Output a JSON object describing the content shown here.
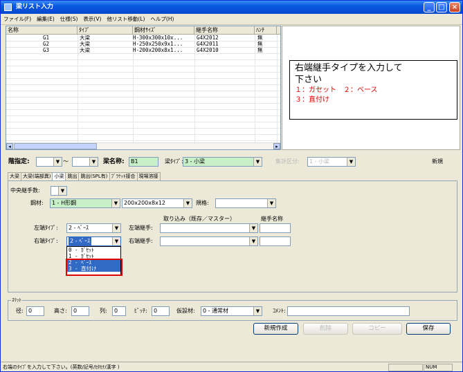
{
  "window": {
    "title": "梁リスト入力"
  },
  "menu": [
    "ファイル(F)",
    "編集(E)",
    "仕様(S)",
    "表示(V)",
    "他リスト移動(L)",
    "ヘルプ(H)"
  ],
  "list": {
    "headers": [
      "名称",
      "ﾀｲﾌﾟ",
      "鋼材ｻｲｽﾞ",
      "継手名称",
      "ﾊﾝﾁ"
    ],
    "rows": [
      [
        "G1",
        "大梁",
        "H-300x300x10x...",
        "G4X2012",
        "無"
      ],
      [
        "G2",
        "大梁",
        "H-250x250x9x1...",
        "G4X2011",
        "無"
      ],
      [
        "G3",
        "大梁",
        "H-200x200x8x1...",
        "G4X2010",
        "無"
      ]
    ]
  },
  "message": {
    "line1": "右端継手タイプを入力して",
    "line2": "下さい",
    "line3": "１：ガセット　２：ベース",
    "line4": "３：直付け"
  },
  "header_form": {
    "floor_label": "階指定:",
    "tilde": "～",
    "name_label": "梁名称:",
    "name_value": "B1",
    "type_label": "梁ﾀｲﾌﾟ:",
    "type_value": "3 - 小梁",
    "agg_label": "集計区分:",
    "agg_value": "1 - 小梁",
    "new_button": "新規"
  },
  "tabs": [
    "大梁",
    "大梁(端部異)",
    "小梁",
    "跳出",
    "跳出(SPL有)",
    "ﾌﾞﾗｹｯﾄ接合",
    "現場溶接"
  ],
  "active_tab": 2,
  "beam_form": {
    "center_joint_label": "中央継手数:",
    "steel_label": "鋼材:",
    "steel_type": "1 - H形鋼",
    "steel_size": "200x200x8x12",
    "spec_label": "規格:",
    "import_label": "取り込み（既存／マスター）",
    "joint_name_label": "継手名称",
    "left_type_label": "左端ﾀｲﾌﾟ:",
    "left_type_value": "2 - ﾍﾞｰｽ",
    "left_joint_label": "左端継手:",
    "right_type_label": "右端ﾀｲﾌﾟ:",
    "right_type_value": "2 - ﾍﾞｰｽ",
    "right_joint_label": "右端継手:"
  },
  "dropdown": {
    "options": [
      "0 - ｶﾞｾｯﾄ",
      "1 - ｶﾞｾｯﾄ",
      "2 - ﾍﾞｰｽ",
      "3 - 直付け"
    ],
    "selected": [
      2,
      3
    ]
  },
  "slot": {
    "legend": "ｽﾘｯﾄ",
    "diameter_label": "径:",
    "diameter_value": "0",
    "height_label": "高さ:",
    "height_value": "0",
    "column_label": "列:",
    "column_value": "0",
    "pitch_label": "ﾋﾟｯﾁ:",
    "pitch_value": "0",
    "formwork_label": "仮設材:",
    "formwork_value": "0 - 通常材",
    "comment_label": "ｺﾒﾝﾄ:"
  },
  "buttons": {
    "create": "新規作成",
    "delete": "削除",
    "copy": "コピー",
    "save": "保存"
  },
  "status": {
    "text": "右端のﾀｲﾌﾟを入力して下さい。(英数/記号/ｶﾀｶﾅ/漢字 )",
    "num": "NUM"
  }
}
